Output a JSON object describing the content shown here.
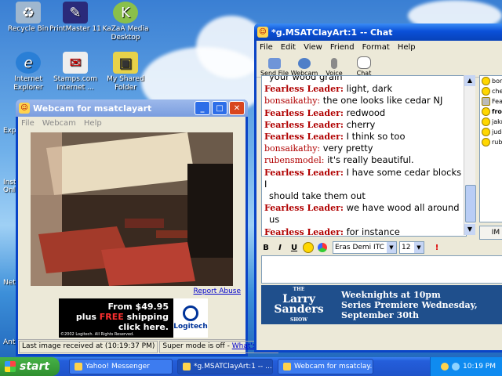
{
  "desktop": {
    "icons": [
      {
        "label": "Recycle Bin",
        "icon": "recycle-bin-icon"
      },
      {
        "label": "PrintMaster 11",
        "icon": "printmaster-icon"
      },
      {
        "label": "KaZaA Media Desktop",
        "icon": "kazaa-icon"
      },
      {
        "label": "Internet Explorer",
        "icon": "internet-explorer-icon"
      },
      {
        "label": "Stamps.com Internet ...",
        "icon": "stamps-icon"
      },
      {
        "label": "My Shared Folder",
        "icon": "shared-folder-icon"
      }
    ],
    "edge_labels": [
      "Exp",
      "Inst Onli",
      "Net",
      "Anti"
    ]
  },
  "webcam": {
    "title": "Webcam for msatclayart",
    "menu": [
      "File",
      "Webcam",
      "Help"
    ],
    "report_abuse": "Report Abuse",
    "ad": {
      "line1": "From $49.95",
      "line2_pre": "plus ",
      "line2_free": "FREE",
      "line2_post": " shipping",
      "line3": "click here.",
      "copyright": "©2002 Logitech. All Rights Reserved.",
      "brand": "Logitech"
    },
    "status_last_image": "Last image received at (10:19:37 PM)",
    "status_super_mode": "Super mode is off - ",
    "status_whats_this": "What's this?"
  },
  "chat": {
    "title": "*g.MSATClayArt:1 -- Chat",
    "menu": [
      "File",
      "Edit",
      "View",
      "Friend",
      "Format",
      "Help"
    ],
    "toolbar": [
      {
        "label": "Send File",
        "icon": "send-file-icon"
      },
      {
        "label": "Webcam",
        "icon": "webcam-icon"
      },
      {
        "label": "Voice",
        "icon": "microphone-icon"
      },
      {
        "label": "Chat",
        "icon": "chat-bubble-icon"
      }
    ],
    "messages": [
      {
        "who": "",
        "text": "your wood grain"
      },
      {
        "who": "Fearless Leader:",
        "text": " light, dark"
      },
      {
        "who": "bonsaikathy:",
        "text": " the one looks like cedar NJ"
      },
      {
        "who": "Fearless Leader:",
        "text": " redwood"
      },
      {
        "who": "Fearless Leader:",
        "text": " cherry"
      },
      {
        "who": "Fearless Leader:",
        "text": " I think so too"
      },
      {
        "who": "bonsaikathy:",
        "text": " very pretty"
      },
      {
        "who": "rubensmodel:",
        "text": " it's really beautiful."
      },
      {
        "who": "Fearless Leader:",
        "text": " I have some cedar blocks I"
      },
      {
        "who": "",
        "text": "should take them out"
      },
      {
        "who": "Fearless Leader:",
        "text": " we have wood all around"
      },
      {
        "who": "",
        "text": "us"
      },
      {
        "who": "Fearless Leader:",
        "text": " for instance"
      }
    ],
    "buddies": [
      "bon",
      "che",
      "Fea",
      "frog",
      "jakn",
      "jude",
      "rube"
    ],
    "im_button": "IM",
    "format": {
      "bold": "B",
      "italic": "I",
      "underline": "U",
      "font": "Eras Demi ITC",
      "size": "12"
    },
    "banner": {
      "show_the": "THE",
      "show_name": "Larry Sanders",
      "show_suffix": "SHOW",
      "line1": "Weeknights at 10pm",
      "line2": "Series Premiere Wednesday,",
      "line3": "September 30th"
    }
  },
  "taskbar": {
    "start": "start",
    "tasks": [
      "Yahoo! Messenger",
      "*g.MSATClayArt:1 -- ...",
      "Webcam for msatclay..."
    ],
    "clock": "10:19 PM"
  }
}
